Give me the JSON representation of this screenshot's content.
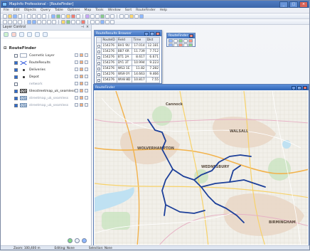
{
  "window": {
    "title": "MapInfo Professional - [RouteFinder]",
    "buttons": {
      "minimize": "_",
      "maximize": "□",
      "close": "×"
    }
  },
  "menu": [
    "File",
    "Edit",
    "Objects",
    "Query",
    "Table",
    "Options",
    "Map",
    "Tools",
    "Window",
    "Sort",
    "RouteFinder",
    "Help"
  ],
  "layer_control": {
    "title": "Layer Control",
    "root": "RouteFinder",
    "layers": [
      {
        "name": "Cosmetic Layer",
        "checked": false,
        "icon": "cosmetic-layer-icon",
        "muted": false
      },
      {
        "name": "RouteResults",
        "checked": true,
        "icon": "route-results-icon",
        "muted": false
      },
      {
        "name": "Deliveries",
        "checked": true,
        "icon": "point-layer-icon",
        "muted": false
      },
      {
        "name": "Depot",
        "checked": true,
        "icon": "point-layer-icon",
        "muted": false
      },
      {
        "name": "network",
        "checked": false,
        "icon": "network-icon",
        "muted": true
      },
      {
        "name": "tilesstreetmap_uk_seamless",
        "checked": true,
        "icon": "streetmap-tile-icon",
        "muted": false
      },
      {
        "name": "streetmap_uk_seamless",
        "checked": true,
        "icon": "map-tile-icon",
        "muted": true
      },
      {
        "name": "streetmap_uk_seamless",
        "checked": true,
        "icon": "map-tile-icon",
        "muted": true
      }
    ]
  },
  "route_browser": {
    "title": "RouteResults Browser",
    "columns": [
      "RouteID",
      "Field",
      "Time",
      "Dist"
    ],
    "rows": [
      [
        "154276",
        "BH1 9U",
        "17.014",
        "12.181"
      ],
      [
        "154276",
        "BB7 6R",
        "11.739",
        "7.712"
      ],
      [
        "154276",
        "BT1 2A",
        "8.617",
        "6.671"
      ],
      [
        "154276",
        "DY1 3T",
        "10.994",
        "9.223"
      ],
      [
        "154276",
        "WS3 1E",
        "11.82",
        "7.282"
      ],
      [
        "154276",
        "WS9 0Y",
        "14.663",
        "9.466"
      ],
      [
        "154276",
        "WV8 8D",
        "10.817",
        "7.55"
      ]
    ]
  },
  "routefinder_panel": {
    "title": "RouteFinder"
  },
  "map_window": {
    "title": "RouteFinder"
  },
  "map_labels": [
    "WALSALL",
    "WEDNESBURY",
    "WOLVERHAMPTON",
    "BIRMINGHAM",
    "Cannock"
  ],
  "status": {
    "zoom": "Zoom: 100,400 m",
    "editing": "Editing: None",
    "selection": "Selection: None"
  },
  "colors": {
    "route": "#1c3f99",
    "titlebar": "#2f64b6"
  }
}
